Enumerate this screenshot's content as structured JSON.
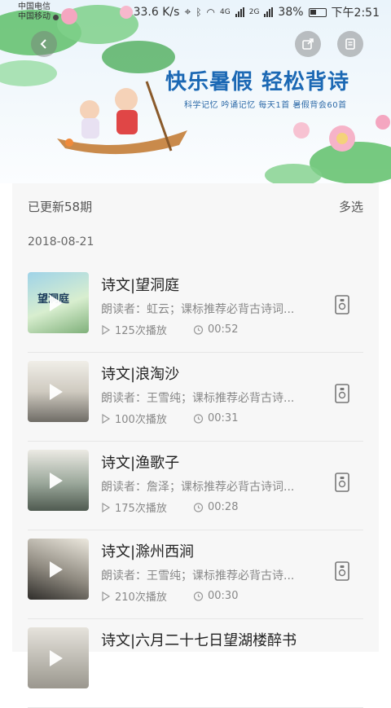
{
  "status_bar": {
    "carrier1": "中国电信",
    "carrier2": "中国移动",
    "speed": "33.6 K/s",
    "net1": "4G",
    "net2": "2G",
    "battery": "38%",
    "time": "下午2:51"
  },
  "banner": {
    "title": "快乐暑假  轻松背诗",
    "subtitle": "科学记忆  吟诵记忆    每天1首 暑假背会60首",
    "thumb_text": "望洞庭"
  },
  "header": {
    "updated": "已更新58期",
    "multi_select": "多选"
  },
  "date": "2018-08-21",
  "items": [
    {
      "title": "诗文|望洞庭",
      "desc": "朗读者：虹云；课标推荐必背古诗词...",
      "plays": "125次播放",
      "duration": "00:52"
    },
    {
      "title": "诗文|浪淘沙",
      "desc": "朗读者：王雪纯；课标推荐必背古诗...",
      "plays": "100次播放",
      "duration": "00:31"
    },
    {
      "title": "诗文|渔歌子",
      "desc": "朗读者：詹泽；课标推荐必背古诗词...",
      "plays": "175次播放",
      "duration": "00:28"
    },
    {
      "title": "诗文|滁州西涧",
      "desc": "朗读者：王雪纯；课标推荐必背古诗...",
      "plays": "210次播放",
      "duration": "00:30"
    },
    {
      "title": "诗文|六月二十七日望湖楼醉书",
      "desc": "",
      "plays": "",
      "duration": ""
    }
  ],
  "colors": {
    "accent": "#1b68b4",
    "muted": "#888888"
  }
}
